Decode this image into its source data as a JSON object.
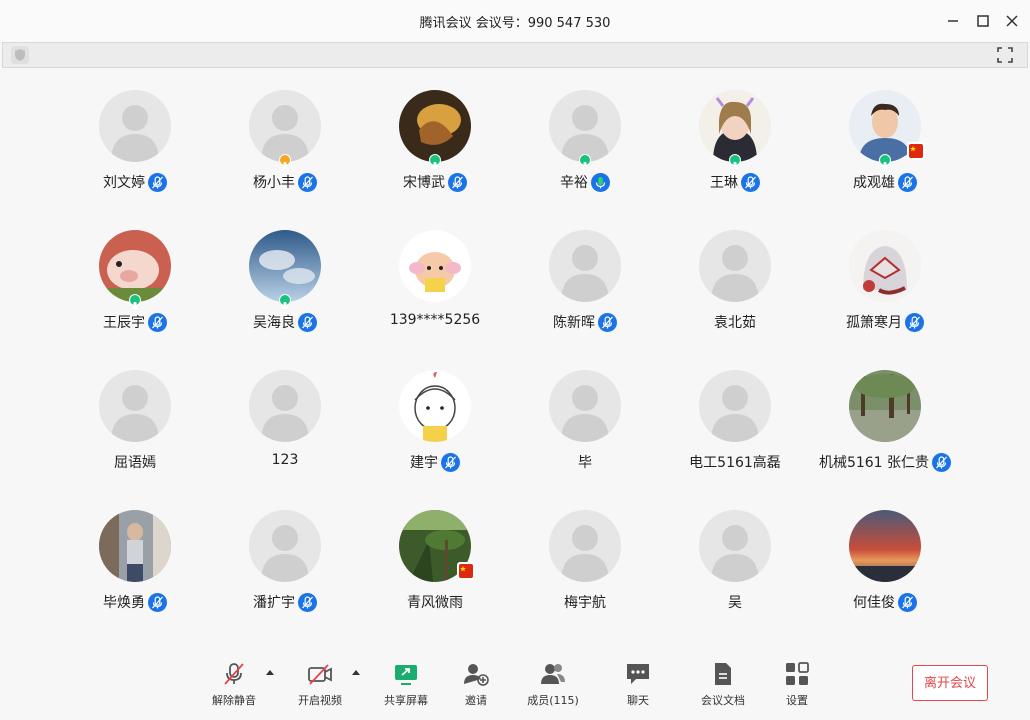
{
  "window": {
    "title": "腾讯会议 会议号：990 547 530"
  },
  "participants": [
    {
      "name": "刘文婷",
      "mic": "muted",
      "avatar": "default"
    },
    {
      "name": "杨小丰",
      "mic": "muted",
      "avatar": "default",
      "badge": "orange"
    },
    {
      "name": "宋博武",
      "mic": "muted",
      "avatar": "photo-dark",
      "badge": "green"
    },
    {
      "name": "辛裕",
      "mic": "active",
      "avatar": "default",
      "badge": "green"
    },
    {
      "name": "王琳",
      "mic": "muted",
      "avatar": "photo-girl",
      "badge": "green"
    },
    {
      "name": "成观雄",
      "mic": "muted",
      "avatar": "photo-man",
      "badge": "green",
      "flag": true
    },
    {
      "name": "王辰宇",
      "mic": "muted",
      "avatar": "photo-pig",
      "badge": "green"
    },
    {
      "name": "吴海良",
      "mic": "muted",
      "avatar": "photo-sky",
      "badge": "green"
    },
    {
      "name": "139****5256",
      "mic": "none",
      "avatar": "photo-cartoon"
    },
    {
      "name": "陈新晖",
      "mic": "muted",
      "avatar": "default"
    },
    {
      "name": "袁北茹",
      "mic": "none",
      "avatar": "default"
    },
    {
      "name": "孤箫寒月",
      "mic": "muted",
      "avatar": "photo-anime"
    },
    {
      "name": "屈语嫣",
      "mic": "none",
      "avatar": "default"
    },
    {
      "name": "123",
      "mic": "none",
      "avatar": "default"
    },
    {
      "name": "建宇",
      "mic": "muted",
      "avatar": "photo-doodle"
    },
    {
      "name": "毕",
      "mic": "none",
      "avatar": "default"
    },
    {
      "name": "电工5161高磊",
      "mic": "none",
      "avatar": "default"
    },
    {
      "name": "机械5161 张仁贵",
      "mic": "muted",
      "avatar": "photo-forest"
    },
    {
      "name": "毕焕勇",
      "mic": "muted",
      "avatar": "photo-city"
    },
    {
      "name": "潘扩宇",
      "mic": "muted",
      "avatar": "default"
    },
    {
      "name": "青风微雨",
      "mic": "none",
      "avatar": "photo-palm",
      "flag": true
    },
    {
      "name": "梅宇航",
      "mic": "none",
      "avatar": "default"
    },
    {
      "name": "吴",
      "mic": "none",
      "avatar": "default"
    },
    {
      "name": "何佳俊",
      "mic": "muted",
      "avatar": "photo-sunset"
    }
  ],
  "toolbar": {
    "unmute_label": "解除静音",
    "video_label": "开启视频",
    "share_label": "共享屏幕",
    "invite_label": "邀请",
    "members_label": "成员(115)",
    "chat_label": "聊天",
    "docs_label": "会议文档",
    "settings_label": "设置",
    "leave_label": "离开会议"
  },
  "colors": {
    "accent": "#1a73e8",
    "leave_red": "#e0474b",
    "status_green": "#19c37d",
    "status_orange": "#f5a623",
    "share_green": "#1aad6e"
  }
}
